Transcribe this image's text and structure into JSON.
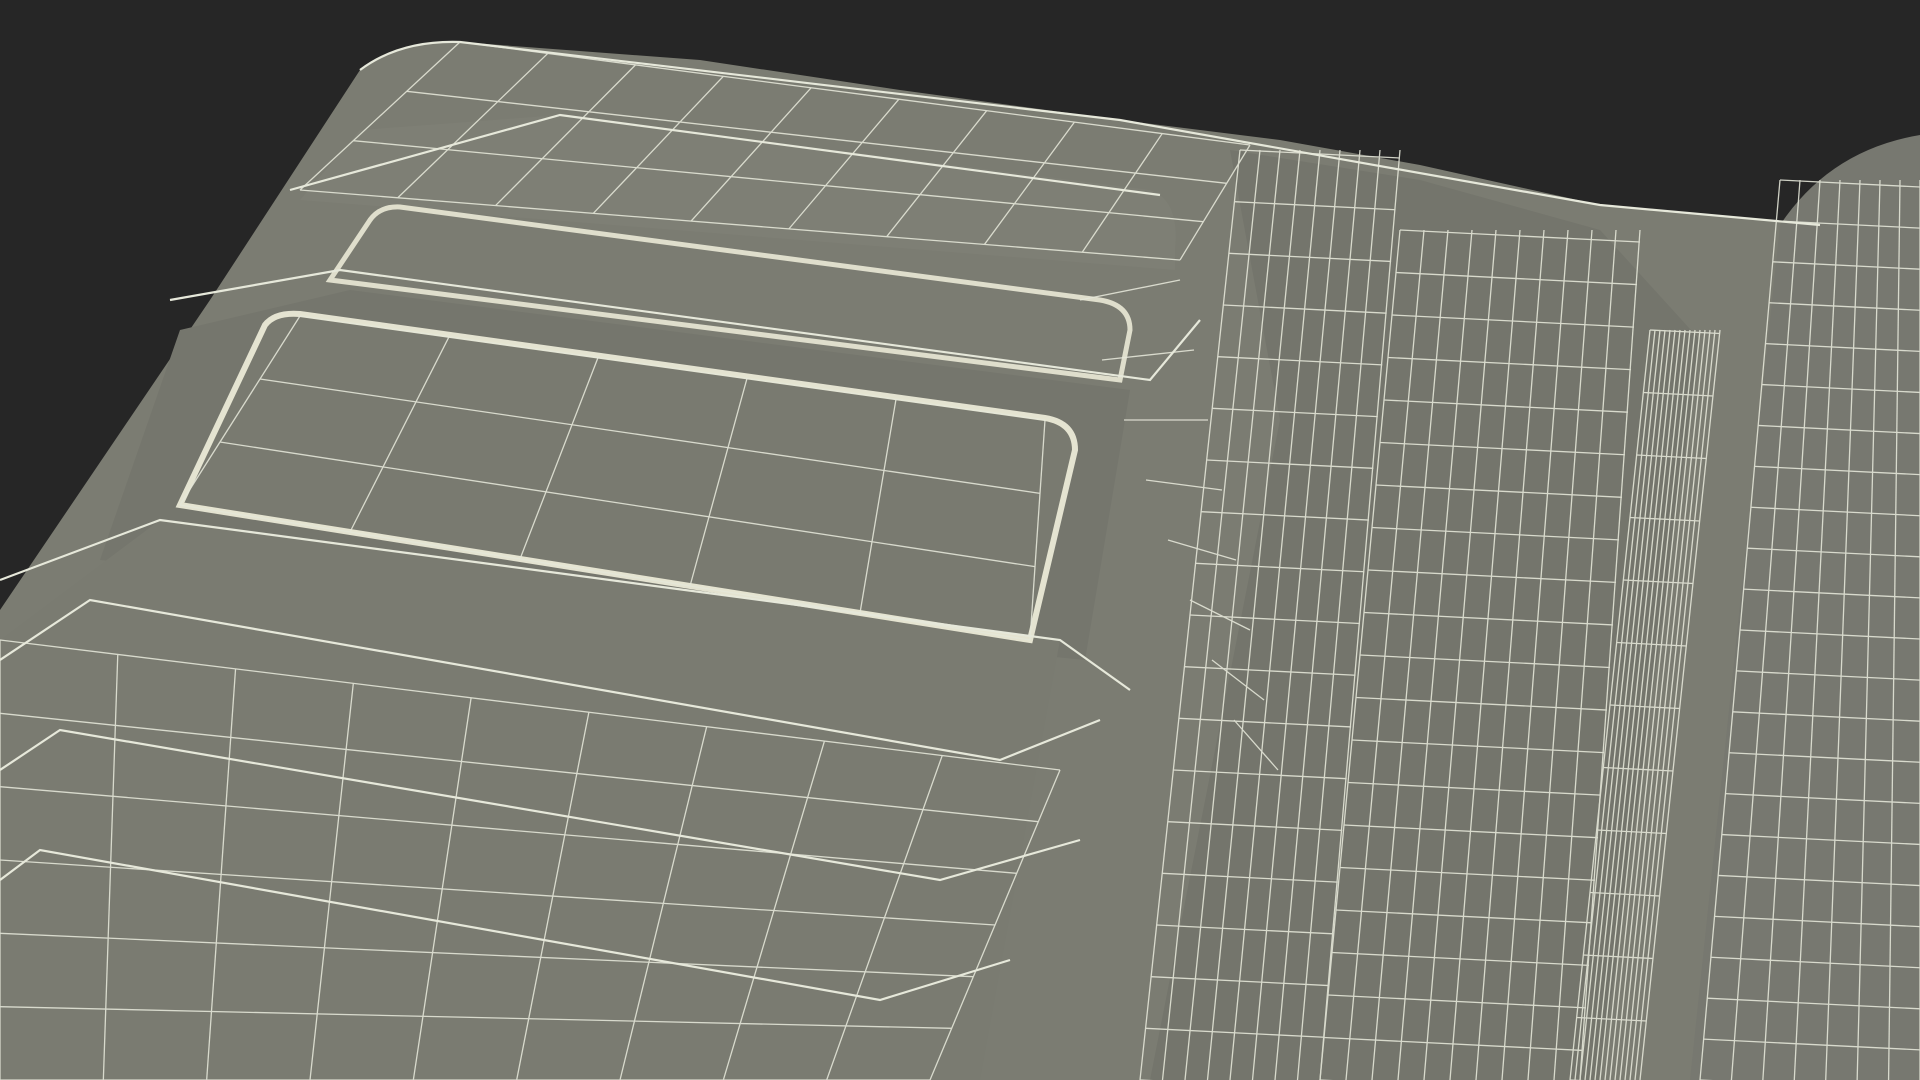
{
  "scene": {
    "subject": "wallet-wireframe-render",
    "colors": {
      "background": "#262626",
      "surface": "#7b7c72",
      "surface_dark": "#6e6f66",
      "surface_light": "#85867b",
      "wire": "#e6e8da",
      "card_edge": "#f1f0dc"
    }
  }
}
